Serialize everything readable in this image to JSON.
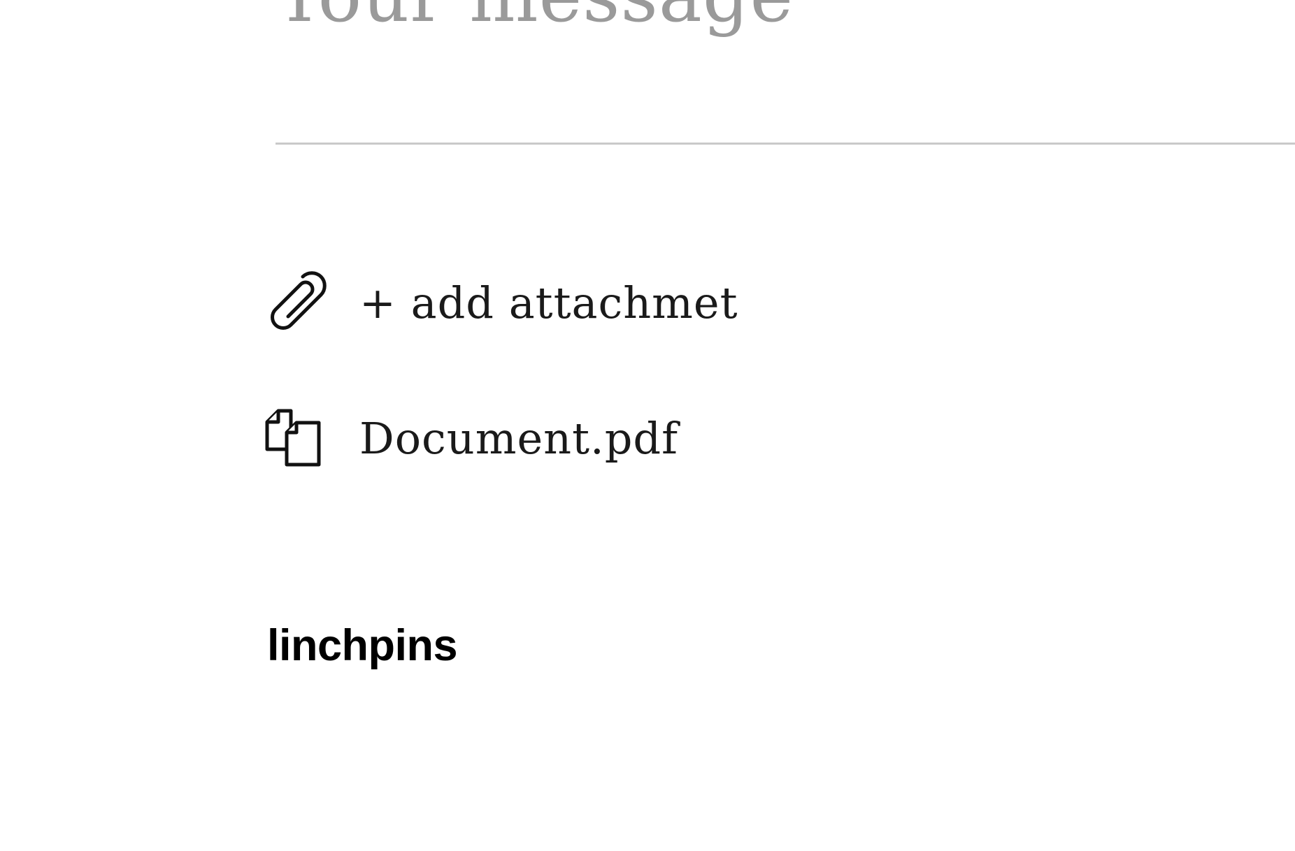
{
  "message": {
    "placeholder": "Your message"
  },
  "attachments": {
    "add_label": "+ add attachmet",
    "add_icon": "paperclip-icon",
    "files": [
      {
        "name": "Document.pdf",
        "icon": "document-icon"
      }
    ]
  },
  "footer": {
    "brand": "linchpins"
  },
  "colors": {
    "placeholder": "#9a9a9a",
    "divider": "#c9c9c9",
    "text": "#1a1a1a",
    "brand": "#000000"
  }
}
